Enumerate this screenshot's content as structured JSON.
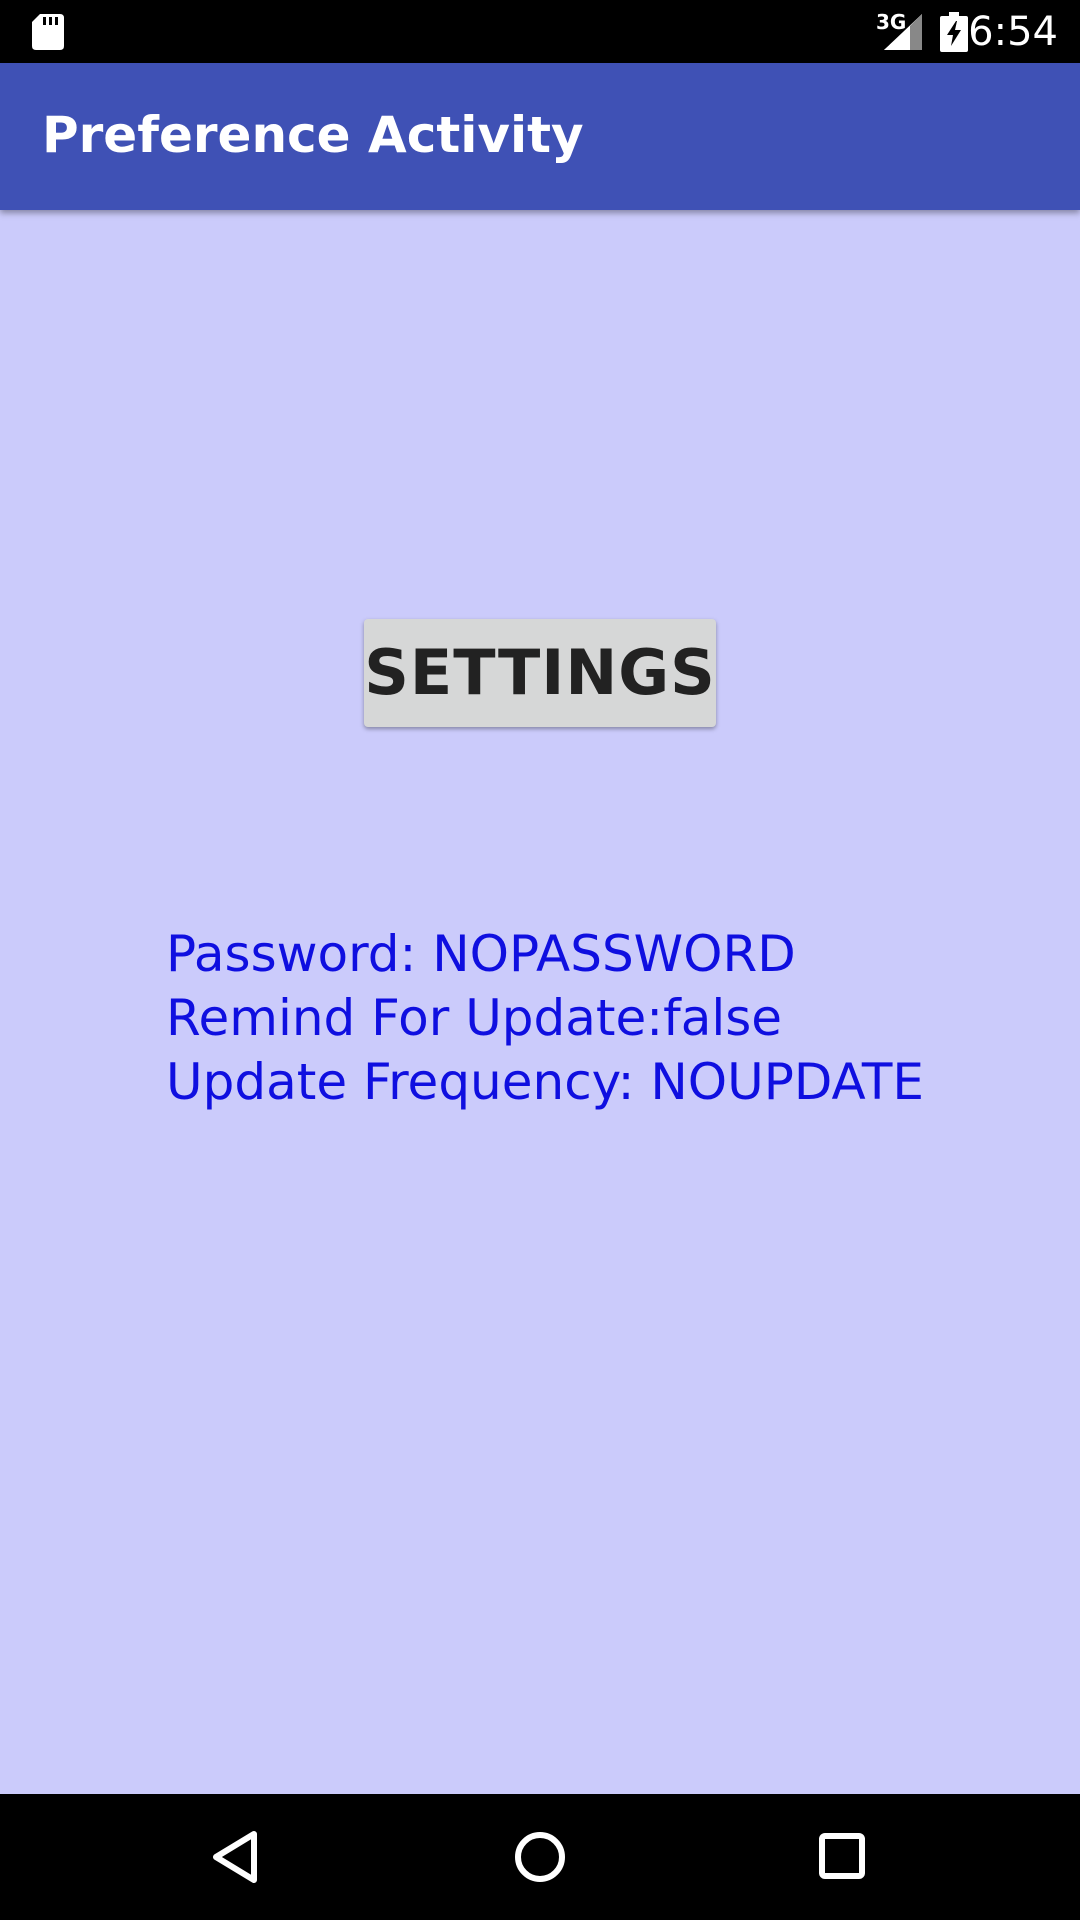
{
  "status_bar": {
    "time": "6:54",
    "network_type": "3G",
    "icons": [
      "sd-card-icon",
      "signal-icon",
      "battery-charging-icon"
    ]
  },
  "app_bar": {
    "title": "Preference Activity"
  },
  "main": {
    "settings_button_label": "SETTINGS",
    "preferences": {
      "password_line": "Password: NOPASSWORD",
      "remind_line": "Remind For Update:false",
      "frequency_line": "Update Frequency: NOUPDATE"
    }
  },
  "nav_bar": {
    "icons": [
      "back-icon",
      "home-icon",
      "recents-icon"
    ]
  },
  "colors": {
    "background": "#cbcbfb",
    "app_bar": "#3f51b5",
    "button": "#d6d7d7",
    "pref_text": "#0f0fe0",
    "status_bar": "#000000",
    "nav_bar": "#000000"
  }
}
